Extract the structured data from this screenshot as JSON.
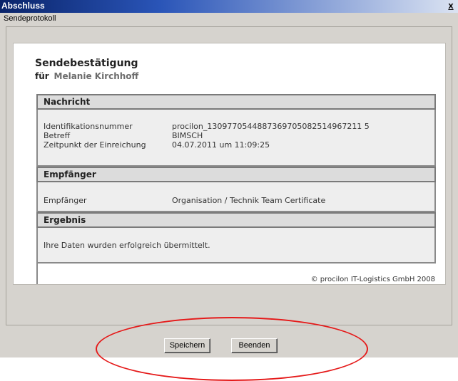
{
  "window": {
    "title": "Abschluss",
    "close_label": "x"
  },
  "group": {
    "label": "Sendeprotokoll"
  },
  "document": {
    "title": "Sendebestätigung",
    "recipient_prefix": "für",
    "recipient_name": "Melanie Kirchhoff",
    "sections": {
      "nachricht": {
        "heading": "Nachricht",
        "rows": [
          {
            "label": "Identifikationsnummer",
            "value": "procilon_1309770544887369705082514967211 5"
          },
          {
            "label": "Betreff",
            "value": "BIMSCH"
          },
          {
            "label": "Zeitpunkt der Einreichung",
            "value": "04.07.2011 um 11:09:25"
          }
        ]
      },
      "empfaenger": {
        "heading": "Empfänger",
        "rows": [
          {
            "label": "Empfänger",
            "value": "Organisation / Technik Team Certificate"
          }
        ]
      },
      "ergebnis": {
        "heading": "Ergebnis",
        "text": "Ihre Daten wurden erfolgreich übermittelt."
      }
    },
    "copyright": "© procilon IT-Logistics GmbH 2008"
  },
  "buttons": {
    "save_label": "Speichern",
    "exit_label": "Beenden"
  },
  "colors": {
    "titlebar_start": "#0a246a",
    "annotation": "#e51a1a",
    "window_bg": "#d6d3ce"
  }
}
